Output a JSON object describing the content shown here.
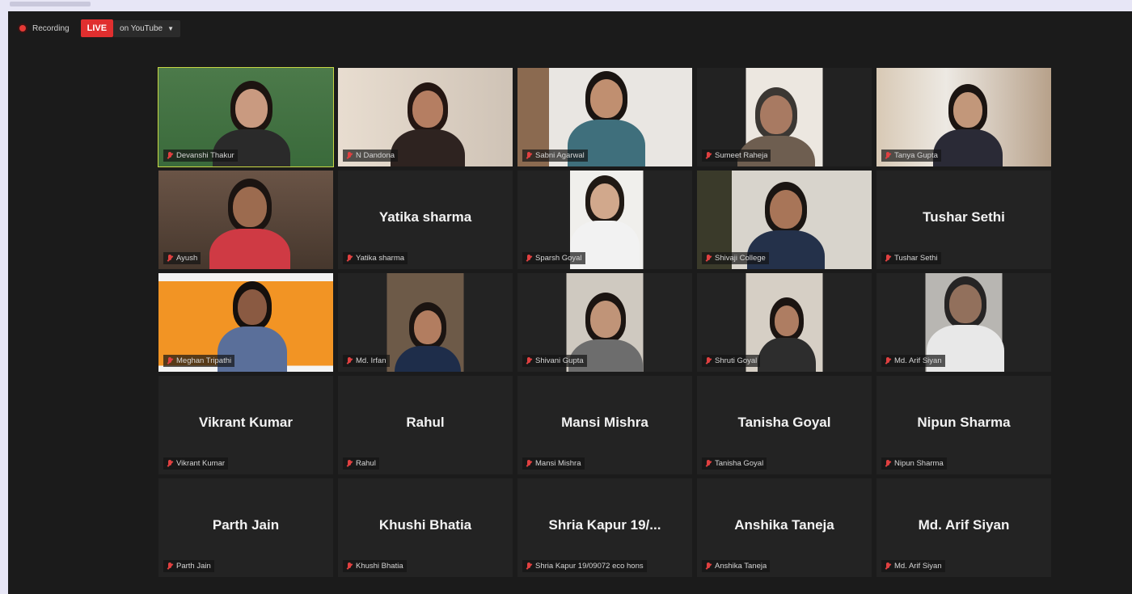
{
  "recording": {
    "label": "Recording",
    "live": "LIVE",
    "stream": "on YouTube"
  },
  "participants": [
    {
      "name": "Devanshi Thakur",
      "display": "",
      "video": true,
      "active": true
    },
    {
      "name": "N Dandona",
      "display": "",
      "video": true
    },
    {
      "name": "Sabni Agarwal",
      "display": "",
      "video": true
    },
    {
      "name": "Sumeet Raheja",
      "display": "",
      "video": true
    },
    {
      "name": "Tanya Gupta",
      "display": "",
      "video": true
    },
    {
      "name": "Ayush",
      "display": "",
      "video": true
    },
    {
      "name": "Yatika sharma",
      "display": "Yatika sharma",
      "video": false
    },
    {
      "name": "Sparsh Goyal",
      "display": "",
      "video": true
    },
    {
      "name": "Shivaji College",
      "display": "",
      "video": true
    },
    {
      "name": "Tushar Sethi",
      "display": "Tushar Sethi",
      "video": false
    },
    {
      "name": "Meghan Tripathi",
      "display": "",
      "video": true
    },
    {
      "name": "Md. Irfan",
      "display": "",
      "video": true
    },
    {
      "name": "Shivani Gupta",
      "display": "",
      "video": true
    },
    {
      "name": "Shruti Goyal",
      "display": "",
      "video": true
    },
    {
      "name": "Md. Arif Siyan",
      "display": "",
      "video": true
    },
    {
      "name": "Vikrant Kumar",
      "display": "Vikrant Kumar",
      "video": false
    },
    {
      "name": "Rahul",
      "display": "Rahul",
      "video": false
    },
    {
      "name": "Mansi Mishra",
      "display": "Mansi Mishra",
      "video": false
    },
    {
      "name": "Tanisha Goyal",
      "display": "Tanisha Goyal",
      "video": false
    },
    {
      "name": "Nipun Sharma",
      "display": "Nipun Sharma",
      "video": false
    },
    {
      "name": "Parth Jain",
      "display": "Parth Jain",
      "video": false
    },
    {
      "name": "Khushi Bhatia",
      "display": "Khushi Bhatia",
      "video": false
    },
    {
      "name": "Shria Kapur 19/09072 eco hons",
      "display": "Shria Kapur 19/...",
      "video": false
    },
    {
      "name": "Anshika Taneja",
      "display": "Anshika Taneja",
      "video": false
    },
    {
      "name": "Md. Arif Siyan",
      "display": "Md. Arif Siyan",
      "video": false
    }
  ],
  "colors": {
    "live": "#e02f2f",
    "active_border": "#c9d845",
    "muted_mic": "#e04040"
  }
}
